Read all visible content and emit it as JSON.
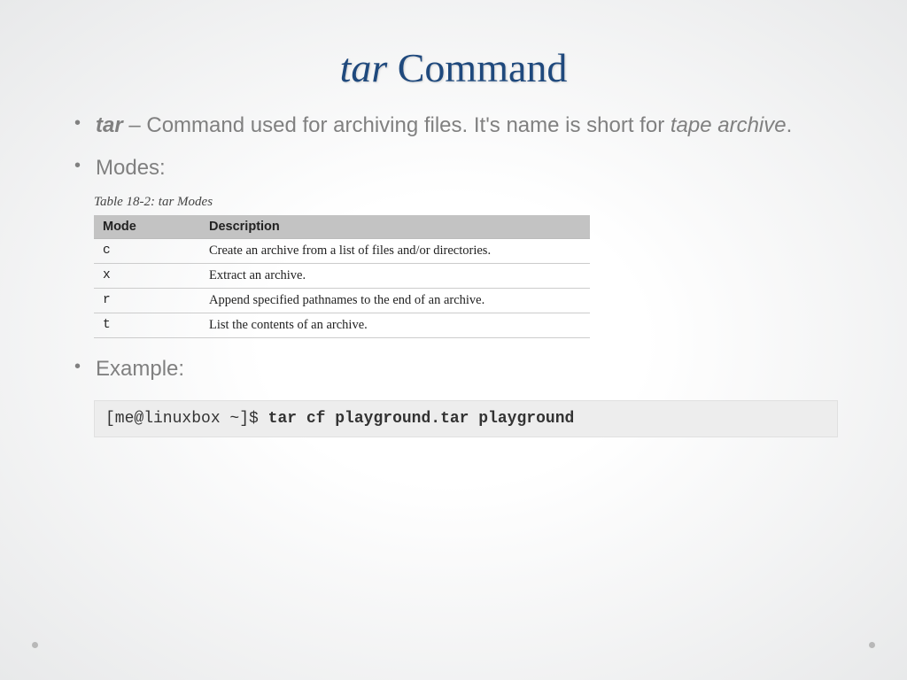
{
  "title": {
    "part1": "tar",
    "part2": " Command"
  },
  "bullets": {
    "b1": {
      "bold": "tar",
      "rest": " – Command used for archiving files. It's name is short for ",
      "ital": "tape archive",
      "tail": "."
    },
    "b2": "Modes:",
    "b3": "Example:"
  },
  "table": {
    "caption": "Table 18-2: tar Modes",
    "headers": {
      "mode": "Mode",
      "desc": "Description"
    },
    "rows": [
      {
        "mode": "c",
        "desc": "Create an archive from a list of files and/or directories."
      },
      {
        "mode": "x",
        "desc": "Extract an archive."
      },
      {
        "mode": "r",
        "desc": "Append specified pathnames to the end of an archive."
      },
      {
        "mode": "t",
        "desc": "List the contents of an archive."
      }
    ]
  },
  "example": {
    "prompt": "[me@linuxbox ~]$ ",
    "command": "tar cf playground.tar playground"
  }
}
